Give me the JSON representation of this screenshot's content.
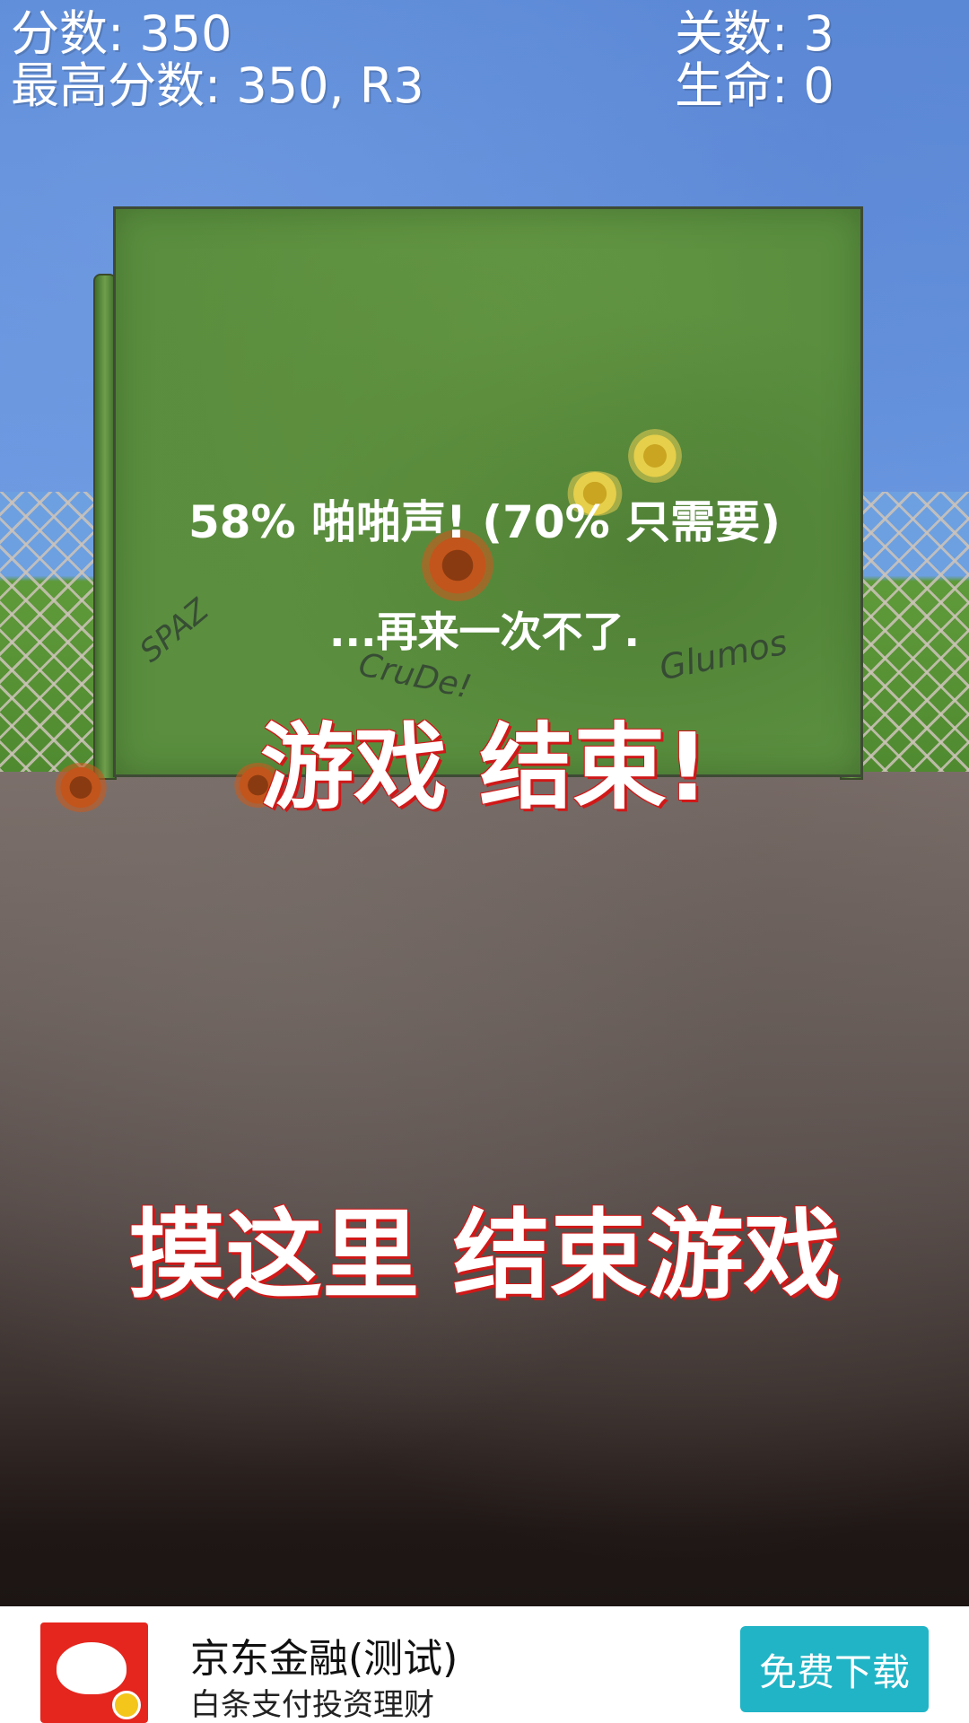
{
  "hud": {
    "score_line": "分数: 350",
    "high_score_line": "最高分数: 350, R3",
    "level_line": "关数: 3",
    "lives_line": "生命: 0"
  },
  "overlay": {
    "splat_message": "58% 啪啪声! (70% 只需要)",
    "retry_message": "...再来一次不了.",
    "game_over": "游戏 结束!",
    "touch_to_end": "摸这里 结束游戏"
  },
  "wall_graffiti": [
    "SPAZ",
    "CruDe!",
    "Glumos"
  ],
  "ad": {
    "title": "京东金融(测试)",
    "subtitle": "白条支付投资理财",
    "button_label": "免费下载"
  },
  "colors": {
    "sky": "#6e9ce2",
    "wall": "#5b8f3f",
    "text_outline": "#d01818",
    "ad_button": "#20b4c6"
  }
}
